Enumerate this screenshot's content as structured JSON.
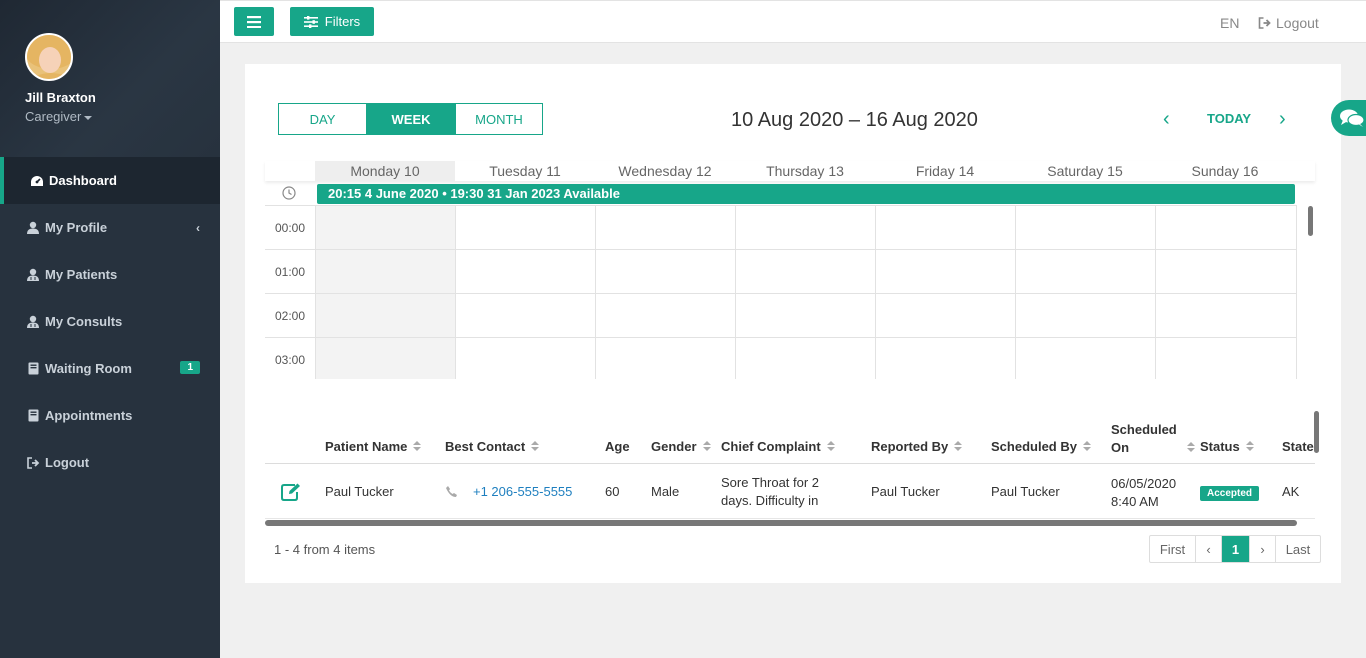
{
  "user": {
    "name": "Jill Braxton",
    "role": "Caregiver"
  },
  "sidebar": {
    "items": [
      {
        "label": "Dashboard",
        "icon": "dashboard-icon",
        "active": true
      },
      {
        "label": "My Profile",
        "icon": "user-icon"
      },
      {
        "label": "My Patients",
        "icon": "user-md-icon"
      },
      {
        "label": "My Consults",
        "icon": "user-md-icon"
      },
      {
        "label": "Waiting Room",
        "icon": "book-icon",
        "badge": "1"
      },
      {
        "label": "Appointments",
        "icon": "book-icon"
      },
      {
        "label": "Logout",
        "icon": "sign-out-icon"
      }
    ]
  },
  "topbar": {
    "filters_label": "Filters",
    "lang": "EN",
    "logout_label": "Logout"
  },
  "calendar": {
    "views": {
      "day": "DAY",
      "week": "WEEK",
      "month": "MONTH"
    },
    "range": "10 Aug 2020 – 16 Aug 2020",
    "today_label": "TODAY",
    "days": [
      "Monday 10",
      "Tuesday 11",
      "Wednesday 12",
      "Thursday 13",
      "Friday 14",
      "Saturday 15",
      "Sunday 16"
    ],
    "all_day_event": "20:15 4 June 2020 • 19:30 31 Jan 2023 Available",
    "hours": [
      "00:00",
      "01:00",
      "02:00",
      "03:00"
    ]
  },
  "table": {
    "columns": [
      "Patient Name",
      "Best Contact",
      "Age",
      "Gender",
      "Chief Complaint",
      "Reported By",
      "Scheduled By",
      "Scheduled On",
      "Status",
      "State"
    ],
    "scheduled_on_line1": "Scheduled",
    "scheduled_on_line2": "On",
    "rows": [
      {
        "patient_name": "Paul Tucker",
        "contact": "+1 206-555-5555",
        "age": "60",
        "gender": "Male",
        "complaint_line1": "Sore Throat for 2",
        "complaint_line2": "days. Difficulty in",
        "reported_by": "Paul Tucker",
        "scheduled_by": "Paul Tucker",
        "date": "06/05/2020",
        "time": "8:40 AM",
        "status": "Accepted",
        "state": "AK"
      }
    ]
  },
  "pagination": {
    "summary": "1 - 4 from 4 items",
    "first": "First",
    "prev": "‹",
    "current": "1",
    "next": "›",
    "last": "Last"
  },
  "colors": {
    "accent": "#17a689",
    "sidebar": "#27323e",
    "link": "#1e7fbf"
  }
}
